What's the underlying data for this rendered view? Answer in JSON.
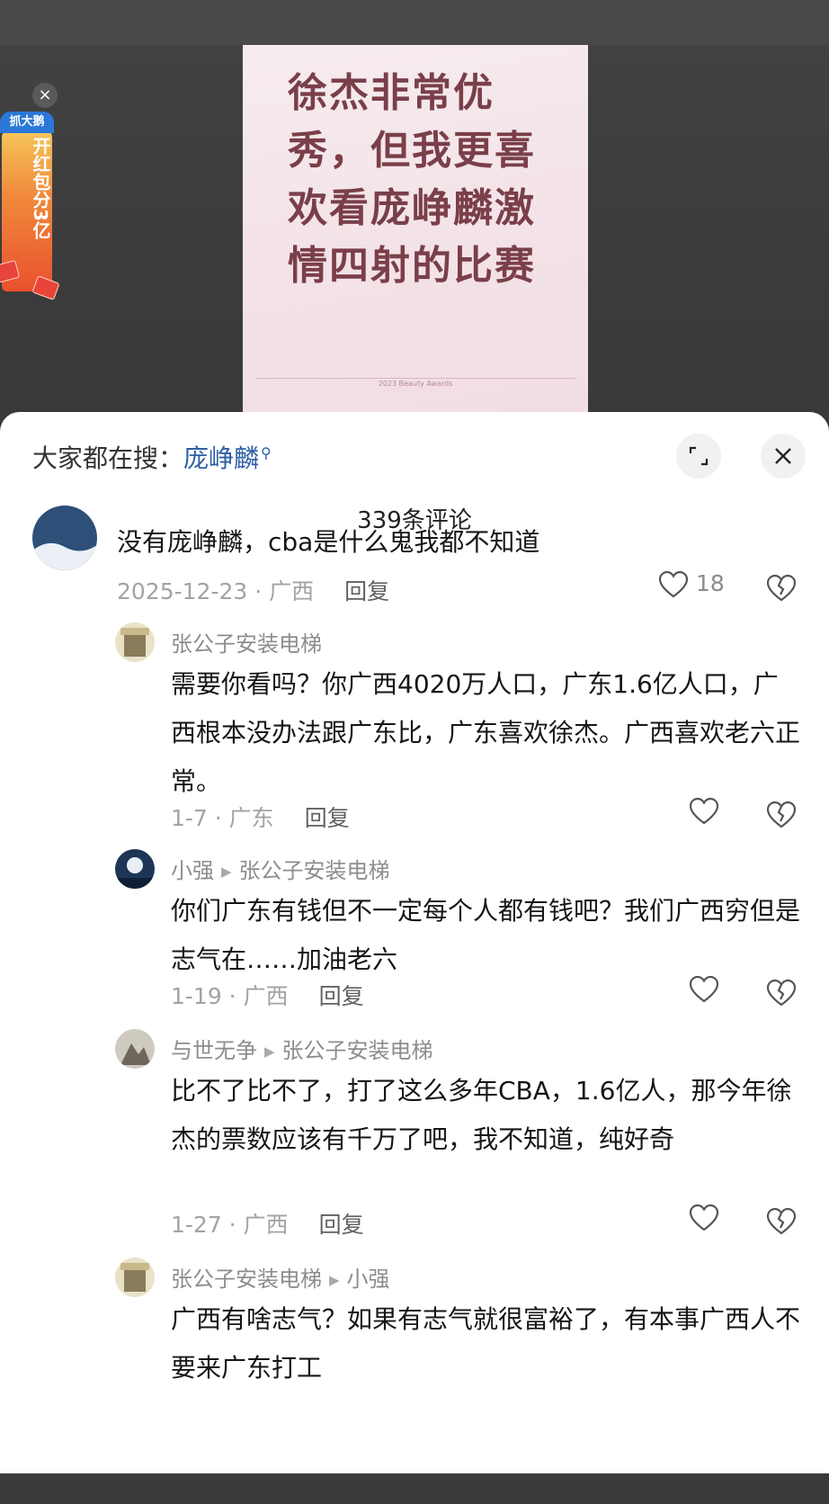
{
  "poster": {
    "headline": "徐杰非常优秀，但我更喜欢看庞峥麟激情四射的比赛",
    "footer": "2023 Beauty Awards"
  },
  "promo": {
    "tag": "抓大鹅",
    "text": "开红包分3亿",
    "close": "×"
  },
  "sheet": {
    "search_label": "大家都在搜：",
    "search_term": "庞峥麟",
    "expand_icon": "expand-icon",
    "close_icon": "close-icon",
    "comment_count": "339条评论"
  },
  "comments": [
    {
      "body": "没有庞峥麟，cba是什么鬼我都不知道",
      "meta": "2025-12-23 · 广西",
      "reply": "回复",
      "likes": "18"
    },
    {
      "name": "张公子安装电梯",
      "body": "需要你看吗？你广西4020万人口，广东1.6亿人口，广西根本没办法跟广东比，广东喜欢徐杰。广西喜欢老六正常。",
      "meta": "1-7 · 广东",
      "reply": "回复"
    },
    {
      "name": "小强",
      "reply_to": "张公子安装电梯",
      "body": "你们广东有钱但不一定每个人都有钱吧？我们广西穷但是志气在……加油老六",
      "meta": "1-19 · 广西",
      "reply": "回复"
    },
    {
      "name": "与世无争",
      "reply_to": "张公子安装电梯",
      "body": "比不了比不了，打了这么多年CBA，1.6亿人，那今年徐杰的票数应该有千万了吧，我不知道，纯好奇",
      "meta": "1-27 · 广西",
      "reply": "回复"
    },
    {
      "name": "张公子安装电梯",
      "reply_to": "小强",
      "body": "广西有啥志气？如果有志气就很富裕了，有本事广西人不要来广东打工"
    }
  ],
  "colors": {
    "accent": "#2d5fa5",
    "poster_text": "#7a3f49",
    "meta": "#a3a3a3"
  }
}
